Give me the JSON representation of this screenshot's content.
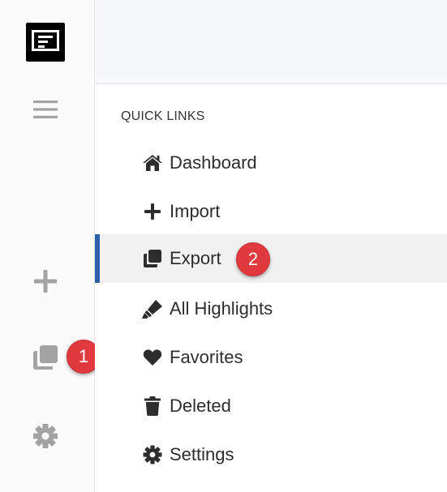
{
  "sidebar": {
    "logo": "app-logo",
    "icons": [
      "menu-icon",
      "plus-icon",
      "copy-icon",
      "gear-icon"
    ]
  },
  "quick_links": {
    "title": "QUICK LINKS",
    "items": [
      {
        "label": "Dashboard",
        "icon": "home-icon",
        "active": false
      },
      {
        "label": "Import",
        "icon": "plus-icon",
        "active": false
      },
      {
        "label": "Export",
        "icon": "copy-icon",
        "active": true
      },
      {
        "label": "All Highlights",
        "icon": "highlighter-icon",
        "active": false
      },
      {
        "label": "Favorites",
        "icon": "heart-icon",
        "active": false
      },
      {
        "label": "Deleted",
        "icon": "trash-icon",
        "active": false
      },
      {
        "label": "Settings",
        "icon": "gear-icon",
        "active": false
      }
    ]
  },
  "annotations": {
    "step1": "1",
    "step2": "2"
  },
  "colors": {
    "active_accent": "#2f5fa8",
    "badge": "#e0393e",
    "rail_icon": "#a0a0a0"
  }
}
